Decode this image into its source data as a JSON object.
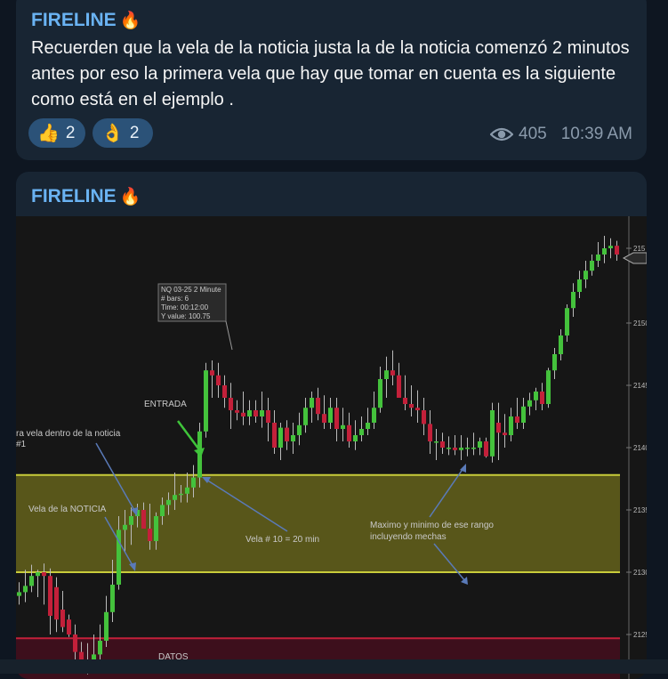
{
  "message1": {
    "sender": "FIRELINE",
    "text": "Recuerden que la vela de la noticia justa la de la noticia comenzó 2 minutos antes por eso la primera vela que hay que tomar en cuenta es la siguiente como está en el ejemplo .",
    "reactions": [
      {
        "emoji": "👍",
        "count": "2"
      },
      {
        "emoji": "👌",
        "count": "2"
      }
    ],
    "views": "405",
    "time": "10:39 AM"
  },
  "message2": {
    "sender": "FIRELINE"
  },
  "photo": {
    "tooltip_lines": [
      "NQ 03-25 2 Minute",
      "# bars:   6",
      "Time:      00:12:00",
      "Y value:  100.75"
    ],
    "price_labels": [
      "215",
      "215",
      "2150",
      "2145",
      "21400",
      "21350.",
      "21300.0",
      "21250.00"
    ],
    "annotations": {
      "entrada": "ENTRADA",
      "primera_vela": "ra vela dentro de la noticia",
      "primera_vela_num": "#1",
      "vela_noticia": "Vela de la NOTICIA",
      "vela_10": "Vela # 10 = 20 min",
      "rango_line1": "Maximo y minimo de ese rango",
      "rango_line2": "incluyendo mechas",
      "datos": "DATOS"
    },
    "colors": {
      "up": "#44c23c",
      "down": "#c3203a",
      "zone": "#5c5a1a",
      "line": "#c8cc3a"
    }
  },
  "chart_data": {
    "type": "candlestick",
    "x": [
      "1",
      "2",
      "3",
      "4",
      "5",
      "6",
      "7",
      "8",
      "9",
      "10",
      "11",
      "12",
      "13",
      "14",
      "15",
      "16",
      "17",
      "18",
      "19",
      "20",
      "21",
      "22",
      "23",
      "24",
      "25",
      "26",
      "27",
      "28",
      "29",
      "30",
      "31",
      "32",
      "33",
      "34",
      "35",
      "36",
      "37",
      "38",
      "39",
      "40",
      "41",
      "42",
      "43",
      "44",
      "45",
      "46",
      "47",
      "48",
      "49",
      "50",
      "51",
      "52",
      "53",
      "54",
      "55",
      "56",
      "57",
      "58",
      "59",
      "60",
      "61",
      "62",
      "63",
      "64",
      "65",
      "66",
      "67",
      "68",
      "69",
      "70",
      "71",
      "72",
      "73",
      "74",
      "75",
      "76",
      "77",
      "78",
      "79",
      "80",
      "81",
      "82",
      "83",
      "84",
      "85",
      "86",
      "87",
      "88",
      "89",
      "90",
      "91",
      "92",
      "93",
      "94",
      "95",
      "96",
      "97"
    ],
    "open": [
      21281,
      21284,
      21289,
      21297,
      21300,
      21297,
      21288,
      21270,
      21262,
      21250,
      21236,
      21228,
      21225,
      21234,
      21245,
      21268,
      21290,
      21334,
      21338,
      21345,
      21350,
      21335,
      21325,
      21345,
      21354,
      21358,
      21362,
      21363,
      21368,
      21376,
      21413,
      21462,
      21458,
      21450,
      21440,
      21430,
      21428,
      21425,
      21430,
      21425,
      21430,
      21420,
      21400,
      21416,
      21405,
      21410,
      21418,
      21432,
      21440,
      21427,
      21420,
      21432,
      21415,
      21418,
      21405,
      21410,
      21415,
      21420,
      21432,
      21455,
      21462,
      21458,
      21440,
      21435,
      21432,
      21430,
      21419,
      21405,
      21405,
      21400,
      21400,
      21398,
      21400,
      21400,
      21400,
      21405,
      21393,
      21420,
      21412,
      21410,
      21425,
      21420,
      21433,
      21438,
      21445,
      21435,
      21462,
      21475,
      21490,
      21512,
      21525,
      21535,
      21542,
      21550,
      21555,
      21560,
      21562
    ],
    "high": [
      21292,
      21302,
      21306,
      21302,
      21307,
      21303,
      21296,
      21285,
      21266,
      21258,
      21244,
      21243,
      21250,
      21258,
      21281,
      21310,
      21345,
      21350,
      21352,
      21355,
      21356,
      21355,
      21348,
      21360,
      21364,
      21380,
      21370,
      21380,
      21386,
      21420,
      21468,
      21470,
      21468,
      21458,
      21452,
      21438,
      21445,
      21438,
      21438,
      21445,
      21440,
      21430,
      21420,
      21422,
      21420,
      21428,
      21440,
      21445,
      21448,
      21442,
      21440,
      21440,
      21432,
      21428,
      21422,
      21425,
      21432,
      21445,
      21465,
      21473,
      21478,
      21468,
      21458,
      21450,
      21446,
      21440,
      21430,
      21415,
      21412,
      21409,
      21410,
      21410,
      21408,
      21412,
      21408,
      21408,
      21436,
      21436,
      21427,
      21432,
      21440,
      21440,
      21444,
      21448,
      21452,
      21464,
      21480,
      21495,
      21515,
      21532,
      21542,
      21550,
      21555,
      21565,
      21570,
      21568,
      21566
    ],
    "low": [
      21274,
      21276,
      21284,
      21280,
      21274,
      21250,
      21252,
      21252,
      21248,
      21230,
      21226,
      21218,
      21222,
      21228,
      21240,
      21260,
      21286,
      21316,
      21322,
      21336,
      21338,
      21318,
      21318,
      21338,
      21346,
      21350,
      21356,
      21356,
      21360,
      21368,
      21408,
      21440,
      21440,
      21432,
      21415,
      21422,
      21418,
      21418,
      21420,
      21416,
      21405,
      21395,
      21390,
      21398,
      21395,
      21402,
      21412,
      21420,
      21422,
      21415,
      21415,
      21405,
      21405,
      21400,
      21398,
      21405,
      21410,
      21415,
      21428,
      21440,
      21450,
      21440,
      21430,
      21425,
      21420,
      21410,
      21395,
      21390,
      21395,
      21394,
      21394,
      21390,
      21393,
      21394,
      21394,
      21392,
      21388,
      21390,
      21400,
      21405,
      21415,
      21415,
      21426,
      21430,
      21430,
      21432,
      21455,
      21470,
      21485,
      21505,
      21520,
      21528,
      21538,
      21545,
      21548,
      21552,
      21550
    ],
    "close": [
      21284,
      21289,
      21297,
      21300,
      21297,
      21265,
      21262,
      21256,
      21250,
      21236,
      21228,
      21225,
      21234,
      21245,
      21268,
      21290,
      21334,
      21338,
      21345,
      21350,
      21335,
      21325,
      21345,
      21354,
      21358,
      21362,
      21363,
      21368,
      21376,
      21413,
      21462,
      21458,
      21450,
      21440,
      21430,
      21428,
      21425,
      21430,
      21425,
      21430,
      21420,
      21400,
      21416,
      21405,
      21410,
      21418,
      21432,
      21440,
      21427,
      21420,
      21432,
      21415,
      21418,
      21405,
      21410,
      21415,
      21420,
      21432,
      21455,
      21462,
      21458,
      21440,
      21435,
      21432,
      21430,
      21419,
      21405,
      21405,
      21400,
      21400,
      21398,
      21400,
      21400,
      21400,
      21405,
      21393,
      21430,
      21412,
      21410,
      21425,
      21420,
      21433,
      21438,
      21445,
      21435,
      21462,
      21475,
      21490,
      21512,
      21525,
      21535,
      21542,
      21550,
      21555,
      21560,
      21562,
      21555
    ],
    "ylim": [
      21225,
      21575
    ],
    "hlines": [
      21378,
      21300,
      21247
    ],
    "ylabel": "",
    "xlabel": "",
    "title": ""
  }
}
